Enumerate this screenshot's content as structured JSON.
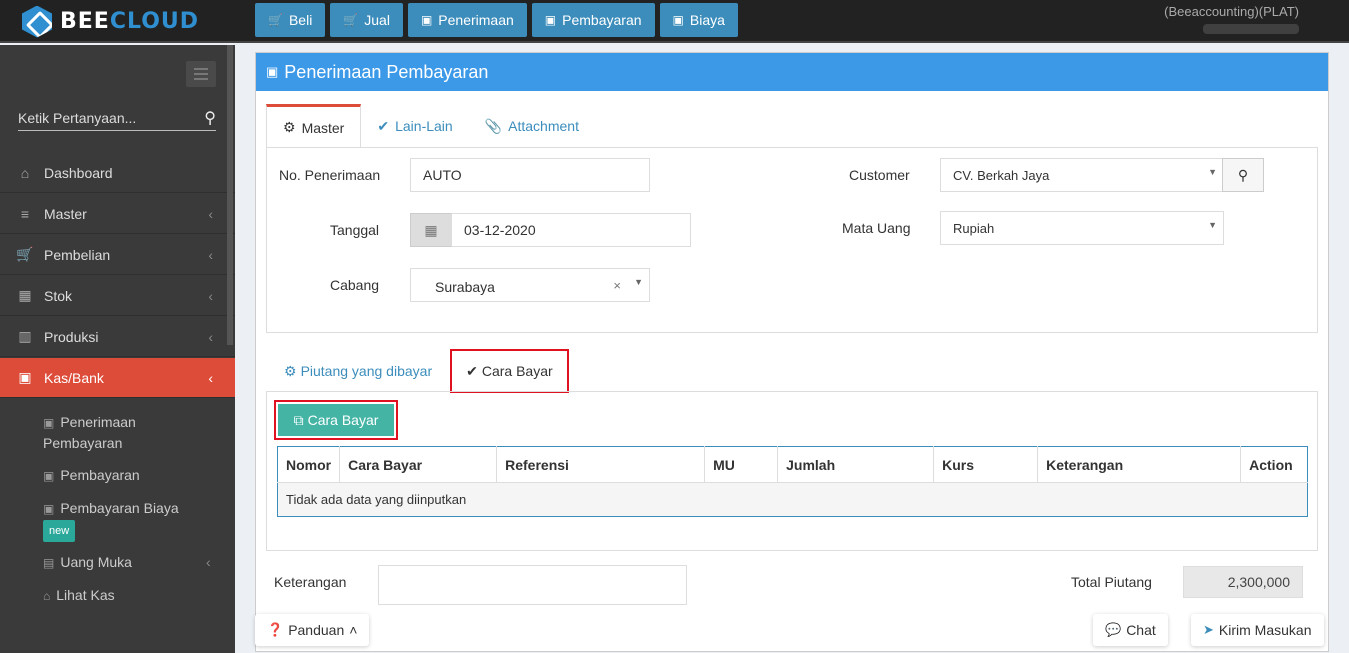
{
  "brand": {
    "bee": "BEE",
    "cloud": "CLOUD"
  },
  "topnav": [
    {
      "icon": "🛒",
      "label": "Beli"
    },
    {
      "icon": "🛒",
      "label": "Jual"
    },
    {
      "icon": "▣",
      "label": "Penerimaan"
    },
    {
      "icon": "▣",
      "label": "Pembayaran"
    },
    {
      "icon": "▣",
      "label": "Biaya"
    }
  ],
  "user": {
    "company": "(Beeaccounting)(PLAT)"
  },
  "sidebar": {
    "search_placeholder": "Ketik Pertanyaan...",
    "items": [
      {
        "icon": "⌂",
        "label": "Dashboard"
      },
      {
        "icon": "≡",
        "label": "Master"
      },
      {
        "icon": "🛒",
        "label": "Pembelian"
      },
      {
        "icon": "▦",
        "label": "Stok"
      },
      {
        "icon": "▥",
        "label": "Produksi"
      },
      {
        "icon": "▣",
        "label": "Kas/Bank"
      }
    ],
    "submenu": [
      {
        "icon": "▣",
        "label": "Penerimaan",
        "label2": "Pembayaran"
      },
      {
        "icon": "▣",
        "label": "Pembayaran"
      },
      {
        "icon": "▣",
        "label": "Pembayaran Biaya",
        "badge": "new"
      },
      {
        "icon": "▤",
        "label": "Uang Muka"
      },
      {
        "icon": "⌂",
        "label": "Lihat Kas"
      }
    ]
  },
  "panel": {
    "title": "Penerimaan Pembayaran",
    "tabs": [
      "Master",
      "Lain-Lain",
      "Attachment"
    ],
    "fields": {
      "no_label": "No. Penerimaan",
      "no_value": "AUTO",
      "tanggal_label": "Tanggal",
      "tanggal_value": "03-12-2020",
      "cabang_label": "Cabang",
      "cabang_value": "Surabaya",
      "customer_label": "Customer",
      "customer_value": "CV. Berkah Jaya",
      "matauang_label": "Mata Uang",
      "matauang_value": "Rupiah"
    },
    "subtabs": [
      "Piutang yang dibayar",
      "Cara Bayar"
    ],
    "add_button": "Cara Bayar",
    "table": {
      "columns": [
        "Nomor",
        "Cara Bayar",
        "Referensi",
        "MU",
        "Jumlah",
        "Kurs",
        "Keterangan",
        "Action"
      ],
      "empty": "Tidak ada data yang diinputkan"
    },
    "keterangan_label": "Keterangan",
    "total_label": "Total Piutang",
    "total_value": "2,300,000"
  },
  "footer": {
    "panduan": "Panduan",
    "chat": "Chat",
    "kirim": "Kirim Masukan"
  }
}
